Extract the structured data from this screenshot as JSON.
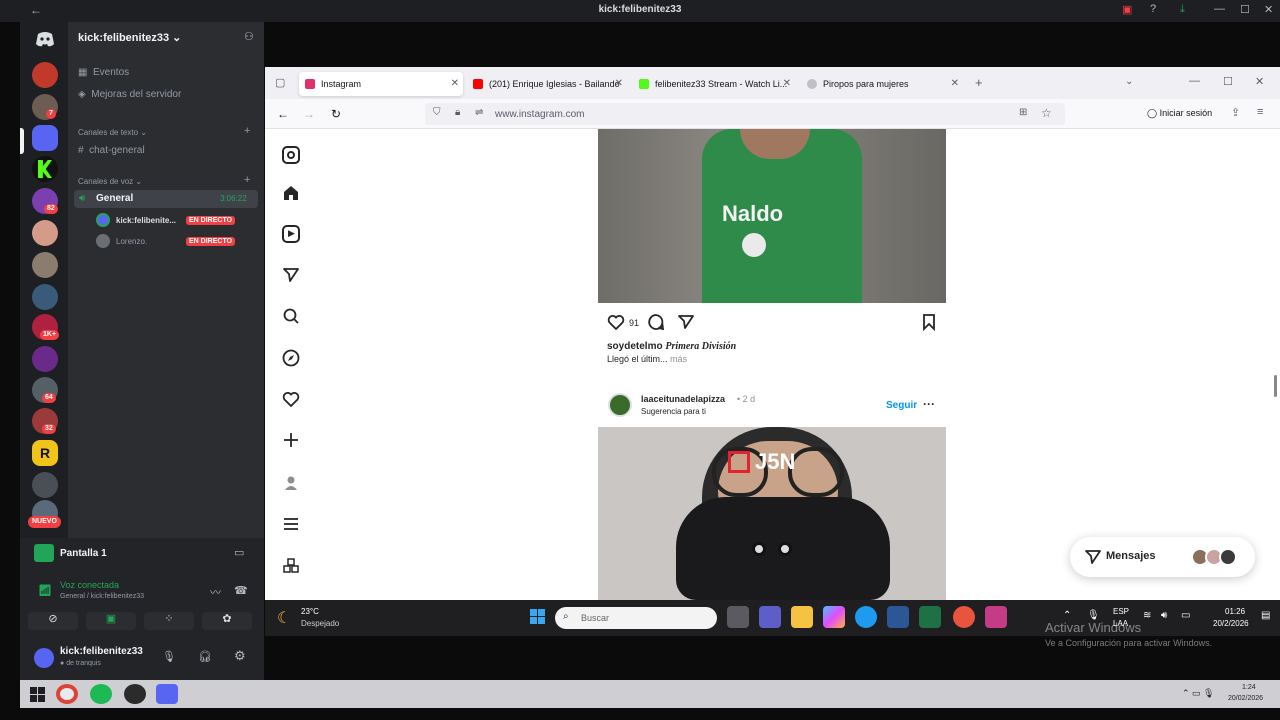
{
  "window": {
    "title": "kick:felibenitez33"
  },
  "discord": {
    "server_name": "kick:felibenitez33",
    "badges": [
      "7",
      "82",
      "1K+",
      "64",
      "32"
    ],
    "new_label": "NUEVO",
    "menu": {
      "events": "Eventos",
      "boosts": "Mejoras del servidor"
    },
    "text_category": "Canales de texto",
    "text_channel": "chat-general",
    "voice_category": "Canales de voz",
    "voice_channel": "General",
    "voice_timer": "3:06:22",
    "voice_users": [
      {
        "name": "kick:felibenite...",
        "status": "EN DIRECTO"
      },
      {
        "name": "Lorenzo.",
        "status": "EN DIRECTO"
      }
    ],
    "screen_share": "Pantalla 1",
    "voice_connected": "Voz conectada",
    "voice_path": "General / kick:felibenitez33",
    "user_name": "kick:felibenitez33",
    "user_status": "de tranquis"
  },
  "browser": {
    "tabs": [
      {
        "label": "Instagram",
        "active": true,
        "color": "#e1306c"
      },
      {
        "label": "(201) Enrique Iglesias - Bailando",
        "active": false,
        "color": "#ff0000"
      },
      {
        "label": "felibenitez33 Stream - Watch Li...",
        "active": false,
        "color": "#53fc18"
      },
      {
        "label": "Piropos para mujeres",
        "active": false,
        "color": "#9aa0a6"
      }
    ],
    "url": "www.instagram.com",
    "signin": "Iniciar sesión"
  },
  "instagram": {
    "post1": {
      "likes": "91",
      "author": "soydetelmo",
      "caption_title": "Primera División",
      "caption": "Llegó el últim...",
      "more": "más",
      "jersey_text": "Naldo"
    },
    "post2": {
      "author": "laaceitunadelapizza",
      "age": "2 d",
      "suggestion": "Sugerencia para ti",
      "follow": "Seguir",
      "overlay_text": "J5N"
    },
    "messages": "Mensajes"
  },
  "taskbar_inner": {
    "weather_temp": "23°C",
    "weather_desc": "Despejado",
    "search_placeholder": "Buscar",
    "lang": "ESP",
    "lang2": "LAA",
    "time": "01:26",
    "date": "20/2/2026"
  },
  "activation": {
    "title": "Activar Windows",
    "subtitle": "Ve a Configuración para activar Windows."
  },
  "taskbar_outer": {
    "time": "1:24",
    "date": "20/02/2026"
  },
  "colors": {
    "discord_bg": "#2b2d31",
    "accent": "#5865f2",
    "live": "#f23f43",
    "voice_green": "#23a559",
    "ig_blue": "#0095f6"
  }
}
